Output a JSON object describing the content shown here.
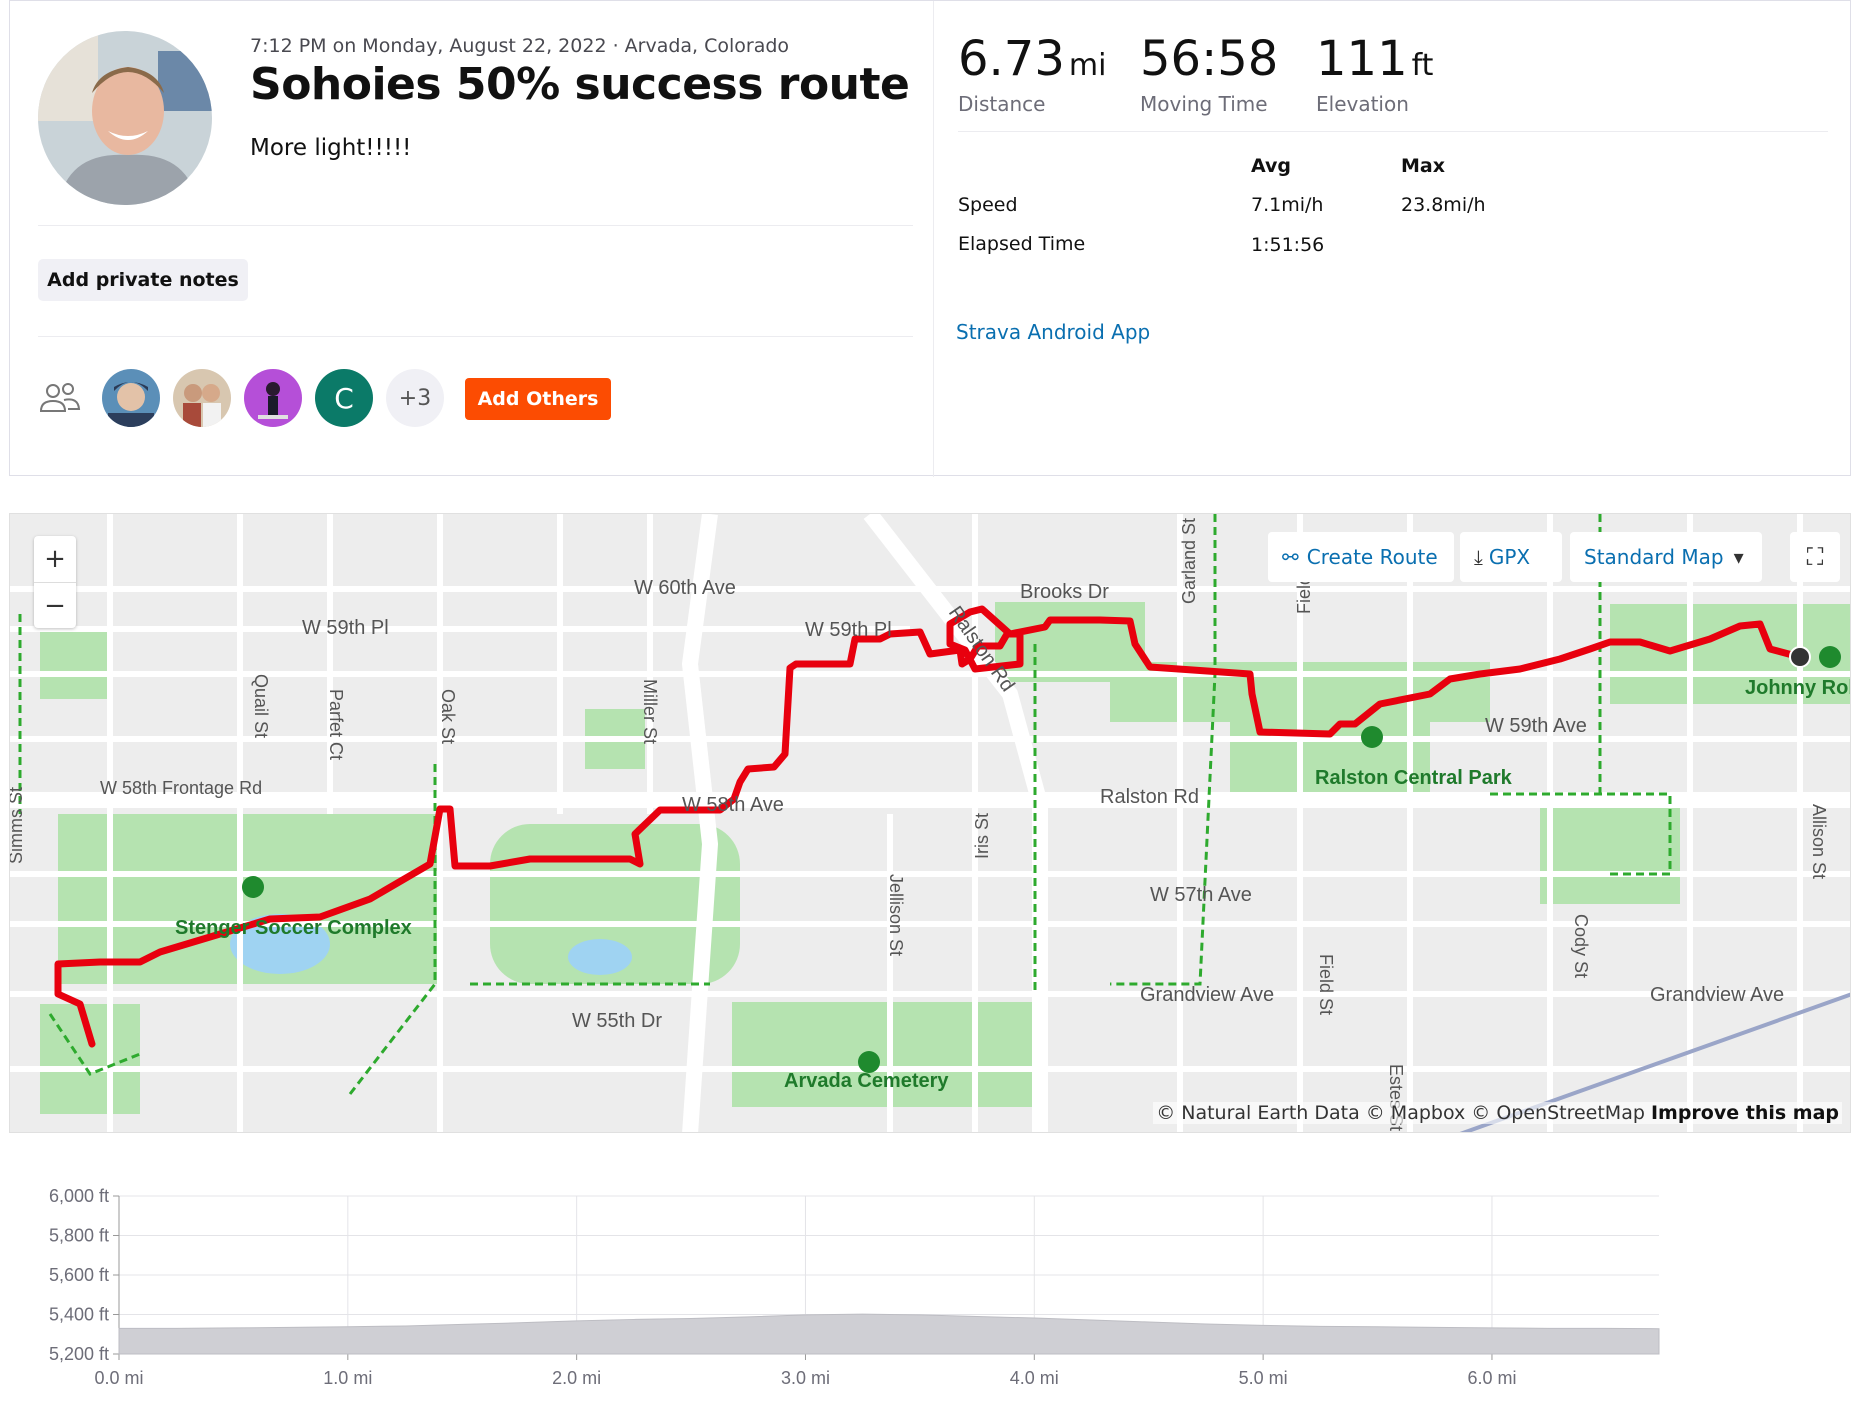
{
  "activity": {
    "meta": "7:12 PM on Monday, August 22, 2022 · Arvada, Colorado",
    "title": "Sohoies 50% success route",
    "description": "More light!!!!!",
    "private_notes_label": "Add private notes"
  },
  "kudos": {
    "initial": "C",
    "more_count": "+3",
    "add_others_label": "Add Others"
  },
  "stats": {
    "distance": {
      "value": "6.73",
      "unit": "mi",
      "label": "Distance"
    },
    "moving_time": {
      "value": "56:58",
      "label": "Moving Time"
    },
    "elevation": {
      "value": "111",
      "unit": "ft",
      "label": "Elevation"
    },
    "table": {
      "avg_header": "Avg",
      "max_header": "Max",
      "speed_label": "Speed",
      "speed_avg": "7.1mi/h",
      "speed_max": "23.8mi/h",
      "elapsed_label": "Elapsed Time",
      "elapsed_avg": "1:51:56"
    },
    "device": "Strava Android App"
  },
  "map": {
    "zoom_in": "+",
    "zoom_out": "−",
    "create_route": "Create Route",
    "gpx": "GPX",
    "map_style": "Standard Map",
    "attribution": "© Natural Earth Data © Mapbox © OpenStreetMap",
    "improve": "Improve this map",
    "streets": [
      "W 60th Ave",
      "W 59th Pl",
      "W 59th Pl",
      "Brooks Dr",
      "Ralston Rd",
      "W 58th Frontage Rd",
      "W 58th Ave",
      "Ralston Rd",
      "W 59th Ave",
      "W 57th Ave",
      "W 55th Dr",
      "Grandview Ave",
      "Grandview Ave",
      "Quail St",
      "Parfet Ct",
      "Oak St",
      "Miller St",
      "Simms St",
      "Jellison St",
      "Iris St",
      "Field St",
      "Field St",
      "Garland St",
      "Cody St",
      "Allison St",
      "Estes St"
    ],
    "parks": [
      "Stenger Soccer Complex",
      "Ralston Central Park",
      "Arvada Cemetery",
      "Johnny Robinson Memorial Park"
    ]
  },
  "chart_data": {
    "type": "area",
    "title": "",
    "xlabel": "",
    "ylabel": "",
    "x_ticks": [
      "0.0 mi",
      "1.0 mi",
      "2.0 mi",
      "3.0 mi",
      "4.0 mi",
      "5.0 mi",
      "6.0 mi"
    ],
    "y_ticks": [
      "6,000 ft",
      "5,800 ft",
      "5,600 ft",
      "5,400 ft",
      "5,200 ft"
    ],
    "xlim": [
      0,
      6.73
    ],
    "ylim": [
      5200,
      6000
    ],
    "grid": true,
    "x": [
      0,
      0.25,
      0.5,
      0.75,
      1.0,
      1.25,
      1.5,
      1.75,
      2.0,
      2.25,
      2.5,
      2.75,
      3.0,
      3.25,
      3.5,
      3.75,
      4.0,
      4.25,
      4.5,
      4.75,
      5.0,
      5.25,
      5.5,
      5.75,
      6.0,
      6.25,
      6.5,
      6.73
    ],
    "series": [
      {
        "values": [
          5330,
          5330,
          5332,
          5335,
          5338,
          5342,
          5350,
          5358,
          5368,
          5375,
          5380,
          5388,
          5398,
          5402,
          5398,
          5390,
          5382,
          5372,
          5362,
          5352,
          5345,
          5340,
          5338,
          5335,
          5332,
          5330,
          5330,
          5328
        ]
      }
    ]
  }
}
